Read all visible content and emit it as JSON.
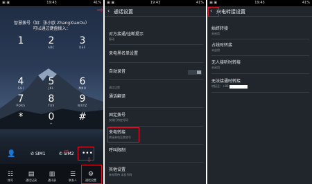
{
  "panel1": {
    "status": {
      "time": "19:43",
      "signal": "41%"
    },
    "hint": "智慧拨号（如：张小欧 ZhangXiaoOu）\n可以通过键盘拨入：",
    "keys": [
      {
        "digit": "1",
        "letters": ""
      },
      {
        "digit": "2",
        "letters": "ABC"
      },
      {
        "digit": "3",
        "letters": "DEF"
      },
      {
        "digit": "4",
        "letters": "GHI"
      },
      {
        "digit": "5",
        "letters": "JKL"
      },
      {
        "digit": "6",
        "letters": "MNO"
      },
      {
        "digit": "7",
        "letters": "PQRS"
      },
      {
        "digit": "8",
        "letters": "TUV"
      },
      {
        "digit": "9",
        "letters": "WXYZ"
      },
      {
        "digit": "*",
        "letters": ""
      },
      {
        "digit": "0",
        "letters": "+"
      },
      {
        "digit": "#",
        "letters": ""
      }
    ],
    "dial": {
      "sim1": "SIM1",
      "sim2": "SIM2",
      "more": "•••"
    },
    "tabs": [
      "拨号",
      "通话记录",
      "通讯录",
      "联系人",
      "通话设置"
    ],
    "accent_red": "#e0162b"
  },
  "panel2": {
    "status": {
      "time": "19:43",
      "signal": "41%"
    },
    "title": "通话设置",
    "items": [
      {
        "title": "对方接通/挂断提示",
        "sub": "振动"
      },
      {
        "title": "来电黑名单设置",
        "sub": ""
      },
      {
        "title": "自动录音",
        "sub": ""
      },
      {
        "title": "通话翻译",
        "sub": ""
      },
      {
        "title": "固定拨号",
        "sub": "仅拨打特定号码"
      },
      {
        "title": "来电转接",
        "sub": "转接来电至其他号"
      },
      {
        "title": "呼叫限制",
        "sub": ""
      },
      {
        "title": "其他设置",
        "sub": "来电等待 本机号码"
      }
    ],
    "section": "通话设置"
  },
  "panel3": {
    "status": {
      "time": "19:43",
      "signal": "41%"
    },
    "title": "来电转接设置",
    "items": [
      {
        "title": "始终转接",
        "sub": "未启用"
      },
      {
        "title": "占线时转接",
        "sub": "未启用"
      },
      {
        "title": "无人接听时转接",
        "sub": "未启用"
      },
      {
        "title": "无法接通时转接",
        "sub": "转接至：+86"
      }
    ]
  }
}
